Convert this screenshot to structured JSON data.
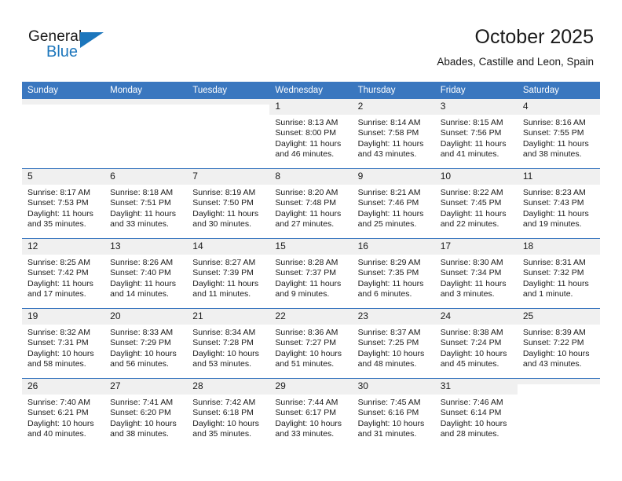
{
  "brand": {
    "name_part1": "General",
    "name_part2": "Blue",
    "accent_color": "#1c76bc"
  },
  "header": {
    "month_title": "October 2025",
    "location": "Abades, Castille and Leon, Spain"
  },
  "calendar": {
    "header_bg": "#3a77bf",
    "daynum_bg": "#f0f0f0",
    "weekdays": [
      "Sunday",
      "Monday",
      "Tuesday",
      "Wednesday",
      "Thursday",
      "Friday",
      "Saturday"
    ],
    "labels": {
      "sunrise": "Sunrise:",
      "sunset": "Sunset:",
      "daylight": "Daylight:"
    },
    "weeks": [
      [
        {
          "day": "",
          "empty": true
        },
        {
          "day": "",
          "empty": true
        },
        {
          "day": "",
          "empty": true
        },
        {
          "day": "1",
          "sunrise": "Sunrise: 8:13 AM",
          "sunset": "Sunset: 8:00 PM",
          "daylight": "Daylight: 11 hours and 46 minutes."
        },
        {
          "day": "2",
          "sunrise": "Sunrise: 8:14 AM",
          "sunset": "Sunset: 7:58 PM",
          "daylight": "Daylight: 11 hours and 43 minutes."
        },
        {
          "day": "3",
          "sunrise": "Sunrise: 8:15 AM",
          "sunset": "Sunset: 7:56 PM",
          "daylight": "Daylight: 11 hours and 41 minutes."
        },
        {
          "day": "4",
          "sunrise": "Sunrise: 8:16 AM",
          "sunset": "Sunset: 7:55 PM",
          "daylight": "Daylight: 11 hours and 38 minutes."
        }
      ],
      [
        {
          "day": "5",
          "sunrise": "Sunrise: 8:17 AM",
          "sunset": "Sunset: 7:53 PM",
          "daylight": "Daylight: 11 hours and 35 minutes."
        },
        {
          "day": "6",
          "sunrise": "Sunrise: 8:18 AM",
          "sunset": "Sunset: 7:51 PM",
          "daylight": "Daylight: 11 hours and 33 minutes."
        },
        {
          "day": "7",
          "sunrise": "Sunrise: 8:19 AM",
          "sunset": "Sunset: 7:50 PM",
          "daylight": "Daylight: 11 hours and 30 minutes."
        },
        {
          "day": "8",
          "sunrise": "Sunrise: 8:20 AM",
          "sunset": "Sunset: 7:48 PM",
          "daylight": "Daylight: 11 hours and 27 minutes."
        },
        {
          "day": "9",
          "sunrise": "Sunrise: 8:21 AM",
          "sunset": "Sunset: 7:46 PM",
          "daylight": "Daylight: 11 hours and 25 minutes."
        },
        {
          "day": "10",
          "sunrise": "Sunrise: 8:22 AM",
          "sunset": "Sunset: 7:45 PM",
          "daylight": "Daylight: 11 hours and 22 minutes."
        },
        {
          "day": "11",
          "sunrise": "Sunrise: 8:23 AM",
          "sunset": "Sunset: 7:43 PM",
          "daylight": "Daylight: 11 hours and 19 minutes."
        }
      ],
      [
        {
          "day": "12",
          "sunrise": "Sunrise: 8:25 AM",
          "sunset": "Sunset: 7:42 PM",
          "daylight": "Daylight: 11 hours and 17 minutes."
        },
        {
          "day": "13",
          "sunrise": "Sunrise: 8:26 AM",
          "sunset": "Sunset: 7:40 PM",
          "daylight": "Daylight: 11 hours and 14 minutes."
        },
        {
          "day": "14",
          "sunrise": "Sunrise: 8:27 AM",
          "sunset": "Sunset: 7:39 PM",
          "daylight": "Daylight: 11 hours and 11 minutes."
        },
        {
          "day": "15",
          "sunrise": "Sunrise: 8:28 AM",
          "sunset": "Sunset: 7:37 PM",
          "daylight": "Daylight: 11 hours and 9 minutes."
        },
        {
          "day": "16",
          "sunrise": "Sunrise: 8:29 AM",
          "sunset": "Sunset: 7:35 PM",
          "daylight": "Daylight: 11 hours and 6 minutes."
        },
        {
          "day": "17",
          "sunrise": "Sunrise: 8:30 AM",
          "sunset": "Sunset: 7:34 PM",
          "daylight": "Daylight: 11 hours and 3 minutes."
        },
        {
          "day": "18",
          "sunrise": "Sunrise: 8:31 AM",
          "sunset": "Sunset: 7:32 PM",
          "daylight": "Daylight: 11 hours and 1 minute."
        }
      ],
      [
        {
          "day": "19",
          "sunrise": "Sunrise: 8:32 AM",
          "sunset": "Sunset: 7:31 PM",
          "daylight": "Daylight: 10 hours and 58 minutes."
        },
        {
          "day": "20",
          "sunrise": "Sunrise: 8:33 AM",
          "sunset": "Sunset: 7:29 PM",
          "daylight": "Daylight: 10 hours and 56 minutes."
        },
        {
          "day": "21",
          "sunrise": "Sunrise: 8:34 AM",
          "sunset": "Sunset: 7:28 PM",
          "daylight": "Daylight: 10 hours and 53 minutes."
        },
        {
          "day": "22",
          "sunrise": "Sunrise: 8:36 AM",
          "sunset": "Sunset: 7:27 PM",
          "daylight": "Daylight: 10 hours and 51 minutes."
        },
        {
          "day": "23",
          "sunrise": "Sunrise: 8:37 AM",
          "sunset": "Sunset: 7:25 PM",
          "daylight": "Daylight: 10 hours and 48 minutes."
        },
        {
          "day": "24",
          "sunrise": "Sunrise: 8:38 AM",
          "sunset": "Sunset: 7:24 PM",
          "daylight": "Daylight: 10 hours and 45 minutes."
        },
        {
          "day": "25",
          "sunrise": "Sunrise: 8:39 AM",
          "sunset": "Sunset: 7:22 PM",
          "daylight": "Daylight: 10 hours and 43 minutes."
        }
      ],
      [
        {
          "day": "26",
          "sunrise": "Sunrise: 7:40 AM",
          "sunset": "Sunset: 6:21 PM",
          "daylight": "Daylight: 10 hours and 40 minutes."
        },
        {
          "day": "27",
          "sunrise": "Sunrise: 7:41 AM",
          "sunset": "Sunset: 6:20 PM",
          "daylight": "Daylight: 10 hours and 38 minutes."
        },
        {
          "day": "28",
          "sunrise": "Sunrise: 7:42 AM",
          "sunset": "Sunset: 6:18 PM",
          "daylight": "Daylight: 10 hours and 35 minutes."
        },
        {
          "day": "29",
          "sunrise": "Sunrise: 7:44 AM",
          "sunset": "Sunset: 6:17 PM",
          "daylight": "Daylight: 10 hours and 33 minutes."
        },
        {
          "day": "30",
          "sunrise": "Sunrise: 7:45 AM",
          "sunset": "Sunset: 6:16 PM",
          "daylight": "Daylight: 10 hours and 31 minutes."
        },
        {
          "day": "31",
          "sunrise": "Sunrise: 7:46 AM",
          "sunset": "Sunset: 6:14 PM",
          "daylight": "Daylight: 10 hours and 28 minutes."
        },
        {
          "day": "",
          "empty": true
        }
      ]
    ]
  }
}
